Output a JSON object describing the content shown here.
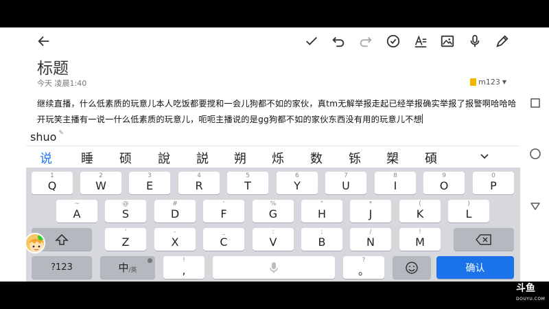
{
  "note": {
    "title": "标题",
    "date": "今天 凌晨1:40",
    "account": "m123",
    "body": "继续直播，什么低素质的玩意儿本人吃饭都要搅和一会儿狗都不如的家伙，真tm无解举报走起已经举报确实举报了报警啊哈哈哈开玩笑主播有一说一什么低素质的玩意儿，呃呃主播说的是gg狗都不如的家伙东西没有用的玩意儿不想"
  },
  "toolbar": {
    "icons": [
      "back-arrow-icon",
      "checkmark-icon",
      "undo-icon",
      "redo-icon",
      "checklist-icon",
      "text-format-icon",
      "image-icon",
      "microphone-icon",
      "pen-icon"
    ]
  },
  "ime": {
    "composition": "shuo",
    "candidates": [
      "说",
      "睡",
      "硕",
      "說",
      "説",
      "朔",
      "烁",
      "数",
      "铄",
      "槊",
      "碩"
    ]
  },
  "keyboard": {
    "row1": [
      {
        "main": "Q",
        "sub": "1"
      },
      {
        "main": "W",
        "sub": "2"
      },
      {
        "main": "E",
        "sub": "3"
      },
      {
        "main": "R",
        "sub": "4"
      },
      {
        "main": "T",
        "sub": "5"
      },
      {
        "main": "Y",
        "sub": "6"
      },
      {
        "main": "U",
        "sub": "7"
      },
      {
        "main": "I",
        "sub": "8"
      },
      {
        "main": "O",
        "sub": "9"
      },
      {
        "main": "P",
        "sub": "0"
      }
    ],
    "row2": [
      {
        "main": "A",
        "sub": "~"
      },
      {
        "main": "S",
        "sub": "@"
      },
      {
        "main": "D",
        "sub": "#"
      },
      {
        "main": "F",
        "sub": "'"
      },
      {
        "main": "G",
        "sub": "%"
      },
      {
        "main": "H",
        "sub": "\""
      },
      {
        "main": "J",
        "sub": "*"
      },
      {
        "main": "K",
        "sub": "("
      },
      {
        "main": "L",
        "sub": ")"
      }
    ],
    "row3": [
      {
        "main": "Z",
        "sub": "'"
      },
      {
        "main": "X",
        "sub": "-"
      },
      {
        "main": "C",
        "sub": "_"
      },
      {
        "main": "V",
        "sub": ":"
      },
      {
        "main": "B",
        "sub": ";"
      },
      {
        "main": "N",
        "sub": "/"
      },
      {
        "main": "M",
        "sub": "!"
      }
    ],
    "symbols_label": "?123",
    "lang_label": "中",
    "lang_sub": "/英",
    "comma_main": ",",
    "comma_sub": "!",
    "period_main": "。",
    "period_sub": "?",
    "confirm_label": "确认"
  },
  "watermark": {
    "logo": "斗鱼",
    "url": "DOUYU.COM"
  },
  "colors": {
    "accent": "#1a73e8",
    "candidate_highlight": "#1e77f0",
    "keyboard_bg": "#d6d8dd"
  }
}
